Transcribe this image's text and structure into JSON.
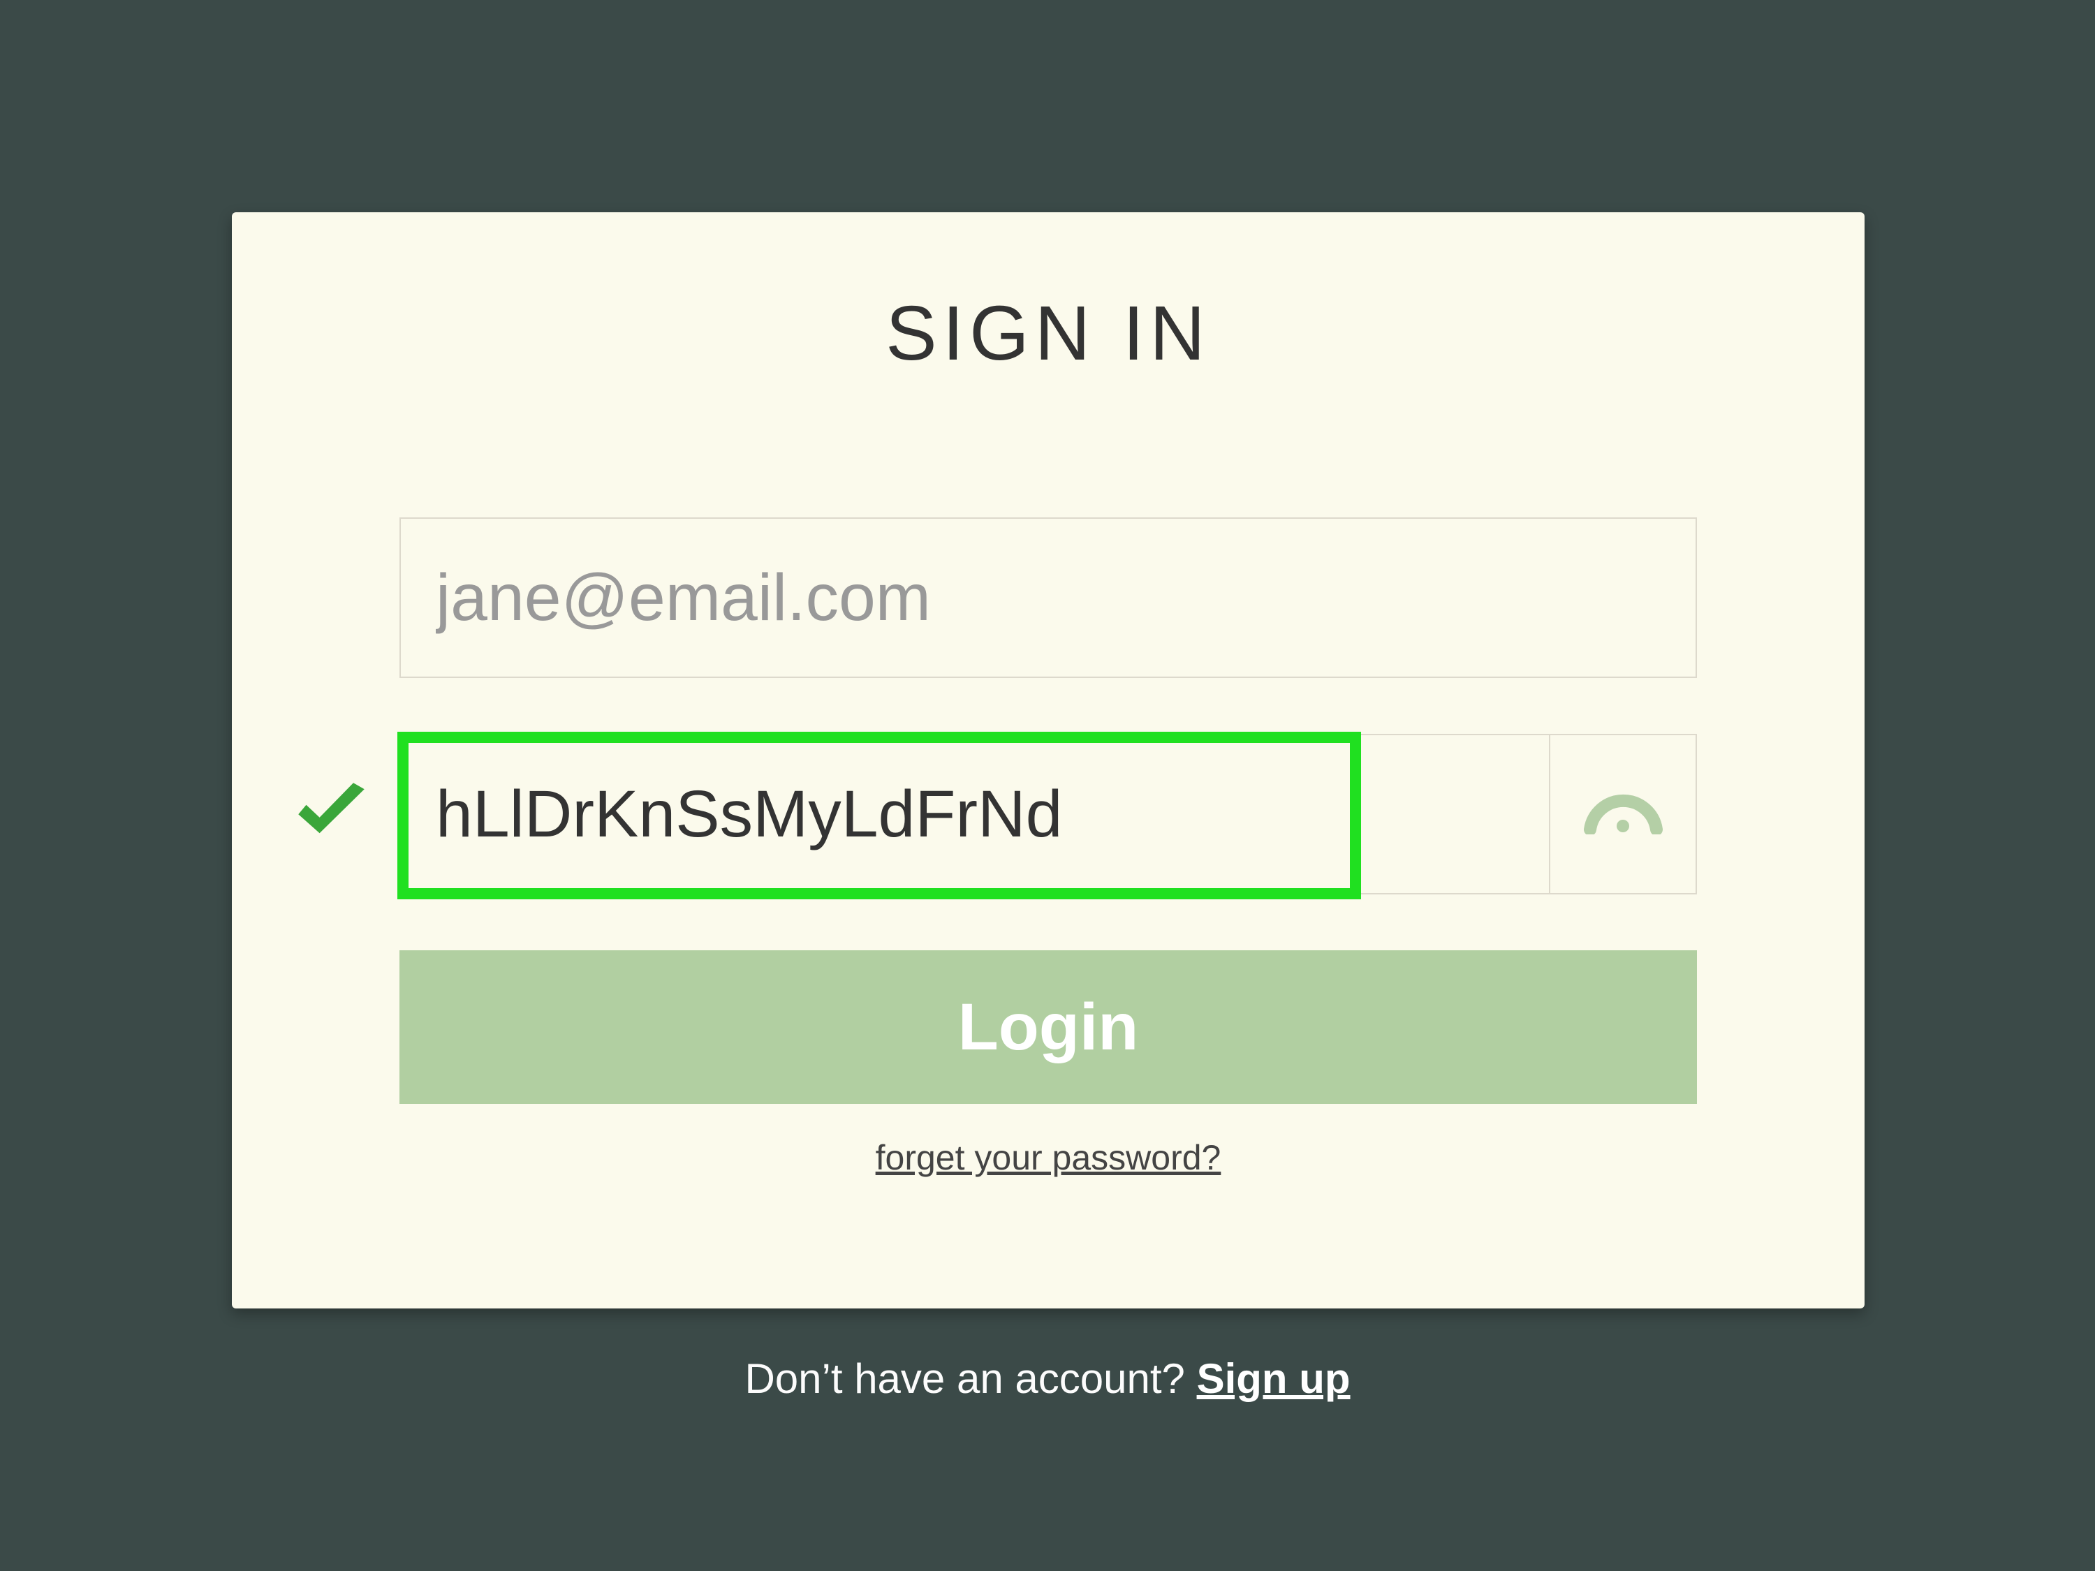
{
  "card": {
    "title": "SIGN IN",
    "email": {
      "placeholder": "jane@email.com",
      "value": ""
    },
    "password": {
      "value": "hLlDrKnSsMyLdFrNd"
    },
    "login_label": "Login",
    "forgot_label": "forget your password?"
  },
  "footer": {
    "prompt": "Don’t have an account? ",
    "signup_label": "Sign up"
  },
  "colors": {
    "background": "#3b4a48",
    "card": "#fbfaec",
    "button": "#b1cfa1",
    "highlight": "#20e020",
    "check": "#3aa63a",
    "eye": "#b4cfa6"
  }
}
